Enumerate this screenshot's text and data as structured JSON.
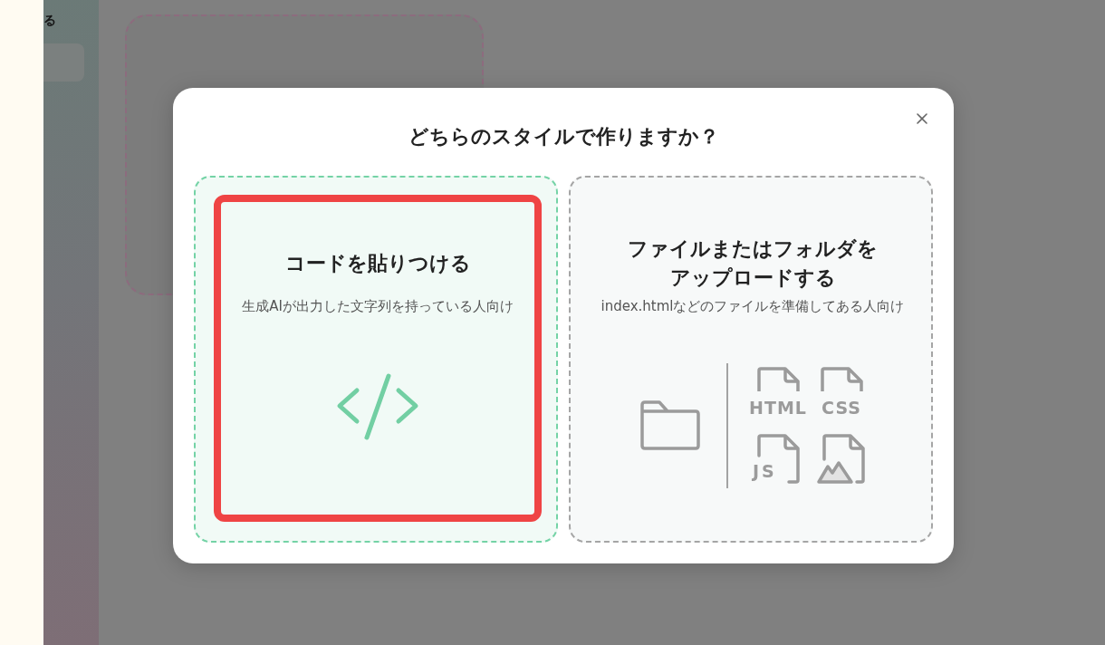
{
  "sidebar": {
    "text": "る"
  },
  "dialog": {
    "title": "どちらのスタイルで作りますか？",
    "options": [
      {
        "kind": "code",
        "selected": true,
        "highlighted": true,
        "title": "コードを貼りつける",
        "description": "生成AIが出力した文字列を持っている人向け"
      },
      {
        "kind": "upload",
        "selected": false,
        "highlighted": false,
        "title": "ファイルまたはフォルダをアップロードする",
        "description": "index.htmlなどのファイルを準備してある人向け",
        "files": [
          {
            "kind": "doc",
            "label": "HTML"
          },
          {
            "kind": "doc",
            "label": "CSS"
          },
          {
            "kind": "script",
            "label": "JS"
          },
          {
            "kind": "image"
          }
        ]
      }
    ]
  }
}
